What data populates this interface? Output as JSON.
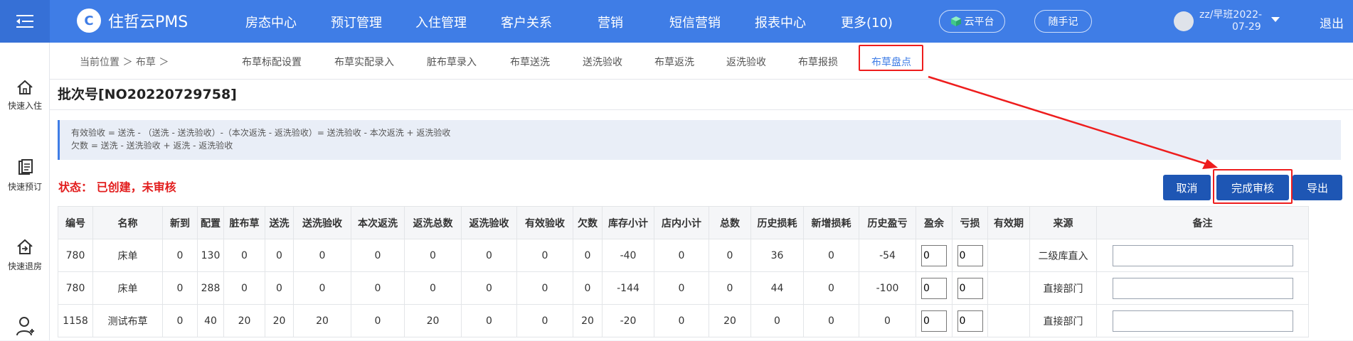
{
  "app": {
    "logo_text": "住哲云PMS",
    "logo_badge": "C",
    "nav": [
      "房态中心",
      "预订管理",
      "入住管理",
      "客户关系",
      "营销",
      "短信营销",
      "报表中心",
      "更多(10)"
    ],
    "cloud_platform": "云平台",
    "notes_button": "随手记",
    "user_line1": "zz/早班2022-",
    "user_line2": "07-29",
    "logout": "退出"
  },
  "sidebar": [
    {
      "label": "快速入住",
      "icon": "home-icon"
    },
    {
      "label": "快速预订",
      "icon": "clipboard-icon"
    },
    {
      "label": "快速退房",
      "icon": "checkout-icon"
    },
    {
      "label": "",
      "icon": "user-add-icon"
    }
  ],
  "breadcrumb": "当前位置 ＞ 布草 ＞",
  "tabs": [
    "布草标配设置",
    "布草实配录入",
    "脏布草录入",
    "布草送洗",
    "送洗验收",
    "布草返洗",
    "返洗验收",
    "布草报损",
    "布草盘点"
  ],
  "active_tab": 8,
  "batch_title": "批次号[NO20220729758]",
  "formula": {
    "line1": "有效验收 = 送洗 - （送洗 - 送洗验收）-（本次返洗 - 返洗验收）= 送洗验收 - 本次返洗 + 返洗验收",
    "line2": "欠数 = 送洗 - 送洗验收 + 返洗 - 返洗验收"
  },
  "status_text": "状态：  已创建，未审核",
  "buttons": {
    "cancel": "取消",
    "approve": "完成审核",
    "export": "导出"
  },
  "table": {
    "headers": [
      "编号",
      "名称",
      "新到",
      "配置",
      "脏布草",
      "送洗",
      "送洗验收",
      "本次返洗",
      "返洗总数",
      "返洗验收",
      "有效验收",
      "欠数",
      "库存小计",
      "店内小计",
      "总数",
      "历史损耗",
      "新增损耗",
      "历史盈亏",
      "盈余",
      "亏损",
      "有效期",
      "来源",
      "备注"
    ],
    "rows": [
      {
        "id": "780",
        "name": "床单",
        "vals": [
          "0",
          "130",
          "0",
          "0",
          "0",
          "0",
          "0",
          "0",
          "0",
          "0",
          "-40",
          "0",
          "0",
          "36",
          "0",
          "-54"
        ],
        "surplus": "0",
        "loss": "0",
        "expiry": "",
        "source": "二级库直入",
        "remark": ""
      },
      {
        "id": "780",
        "name": "床单",
        "vals": [
          "0",
          "288",
          "0",
          "0",
          "0",
          "0",
          "0",
          "0",
          "0",
          "0",
          "-144",
          "0",
          "0",
          "44",
          "0",
          "-100"
        ],
        "surplus": "0",
        "loss": "0",
        "expiry": "",
        "source": "直接部门",
        "remark": ""
      },
      {
        "id": "1158",
        "name": "测试布草",
        "vals": [
          "0",
          "40",
          "20",
          "20",
          "20",
          "0",
          "20",
          "0",
          "0",
          "20",
          "-20",
          "0",
          "20",
          "0",
          "0",
          "0"
        ],
        "surplus": "0",
        "loss": "0",
        "expiry": "",
        "source": "直接部门",
        "remark": ""
      }
    ]
  },
  "colors": {
    "primary": "#3f7de6",
    "button": "#1e56b4",
    "alert": "#e21d1d"
  }
}
